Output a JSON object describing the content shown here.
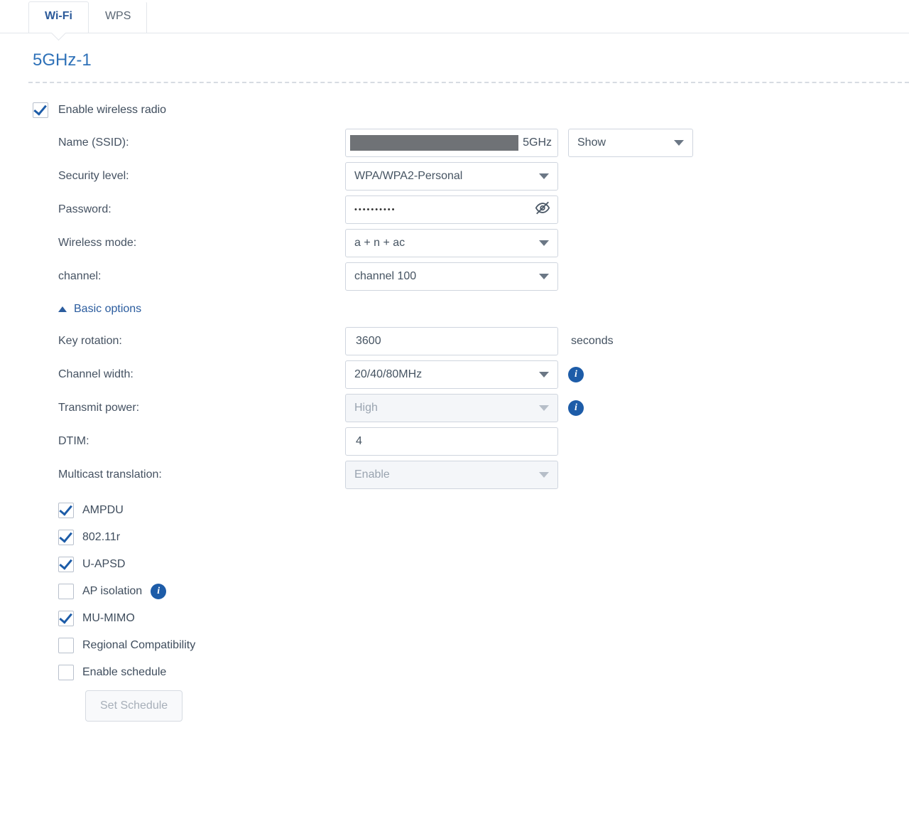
{
  "tabs": {
    "wifi": "Wi-Fi",
    "wps": "WPS"
  },
  "section_title": "5GHz-1",
  "enable_radio": {
    "label": "Enable wireless radio",
    "checked": true
  },
  "fields": {
    "ssid": {
      "label": "Name (SSID):",
      "suffix": "5GHz",
      "show_sel": "Show"
    },
    "security": {
      "label": "Security level:",
      "value": "WPA/WPA2-Personal"
    },
    "password": {
      "label": "Password:",
      "masked": "••••••••••"
    },
    "wireless_mode": {
      "label": "Wireless mode:",
      "value": "a + n + ac"
    },
    "channel": {
      "label": "channel:",
      "value": "channel 100"
    },
    "basic_options": "Basic options",
    "key_rotation": {
      "label": "Key rotation:",
      "value": "3600",
      "unit": "seconds"
    },
    "channel_width": {
      "label": "Channel width:",
      "value": "20/40/80MHz"
    },
    "transmit_power": {
      "label": "Transmit power:",
      "value": "High"
    },
    "dtim": {
      "label": "DTIM:",
      "value": "4"
    },
    "multicast": {
      "label": "Multicast translation:",
      "value": "Enable"
    }
  },
  "checks": {
    "ampdu": {
      "label": "AMPDU",
      "checked": true
    },
    "r80211": {
      "label": "802.11r",
      "checked": true
    },
    "uapsd": {
      "label": "U-APSD",
      "checked": true
    },
    "apiso": {
      "label": "AP isolation",
      "checked": false,
      "info": true
    },
    "mumimo": {
      "label": "MU-MIMO",
      "checked": true
    },
    "regional": {
      "label": "Regional Compatibility",
      "checked": false
    },
    "schedule": {
      "label": "Enable schedule",
      "checked": false
    }
  },
  "set_schedule_btn": "Set Schedule"
}
